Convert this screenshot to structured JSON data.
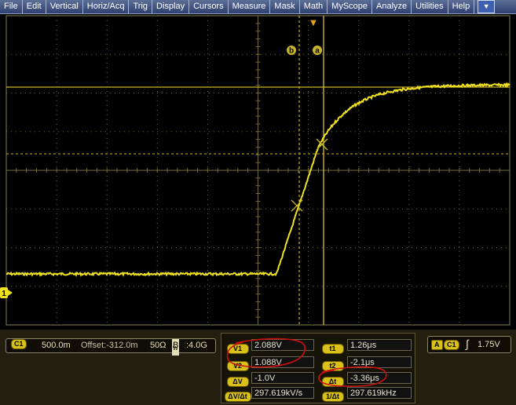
{
  "menu": [
    "File",
    "Edit",
    "Vertical",
    "Horiz/Acq",
    "Trig",
    "Display",
    "Cursors",
    "Measure",
    "Mask",
    "Math",
    "MyScope",
    "Analyze",
    "Utilities",
    "Help"
  ],
  "menu_dropdown_glyph": "▼",
  "colors": {
    "trace": "#f1e21f",
    "grid": "#6f6a3e",
    "cursor": "#c9b428",
    "annotation": "#cc1010"
  },
  "waveform": {
    "channel_marker": "1",
    "cursor_b_label": "b",
    "cursor_a_label": "a",
    "trigger_marker": "▼"
  },
  "channel_settings": {
    "channel": "C1",
    "scale": "500.0m",
    "offset": "Offset:-312.0m",
    "impedance": "50Ω",
    "bandwidth_prefix": "B",
    "bandwidth_sub": "W",
    "bandwidth": ":4.0G"
  },
  "cursors": {
    "v1_label": "V1",
    "v1_value": "2.088V",
    "v2_label": "V2",
    "v2_value": "1.088V",
    "dv_label": "ΔV",
    "dv_value": "-1.0V",
    "dvdt_label": "ΔV/Δt",
    "dvdt_value": "297.619kV/s",
    "t1_label": "t1",
    "t1_value": "1.26μs",
    "t2_label": "t2",
    "t2_value": "-2.1μs",
    "dt_label": "Δt",
    "dt_value": "-3.36μs",
    "inv_dt_label": "1/Δt",
    "inv_dt_value": "297.619kHz"
  },
  "trigger": {
    "mode_label": "A",
    "source_label": "C1",
    "slope_glyph": "∫",
    "level": "1.75V"
  }
}
